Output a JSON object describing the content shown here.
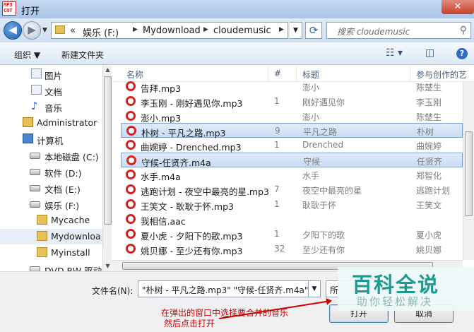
{
  "window": {
    "title": "打开",
    "app_icon_text": "MP3 CUT",
    "close_label": "✕"
  },
  "address": {
    "back_glyph": "◀",
    "forward_glyph": "▶",
    "segments": [
      "«",
      "娱乐 (F:)",
      "Mydownload",
      "cloudemusic"
    ],
    "search_placeholder": "搜索 cloudemusic"
  },
  "toolbar": {
    "organize": "组织",
    "new_folder": "新建文件夹",
    "help": "?"
  },
  "nav": {
    "items": [
      {
        "label": "图片",
        "icon": "picture-icon"
      },
      {
        "label": "文档",
        "icon": "document-icon"
      },
      {
        "label": "音乐",
        "icon": "music-icon"
      },
      {
        "label": "Administrator",
        "icon": "user-icon"
      },
      {
        "label": "计算机",
        "icon": "computer-icon"
      },
      {
        "label": "本地磁盘 (C:)",
        "icon": "drive-icon"
      },
      {
        "label": "软件 (D:)",
        "icon": "drive-icon"
      },
      {
        "label": "文档 (E:)",
        "icon": "drive-icon"
      },
      {
        "label": "娱乐 (F:)",
        "icon": "drive-icon"
      },
      {
        "label": "Mycache",
        "icon": "folder-icon"
      },
      {
        "label": "Mydownloa",
        "icon": "folder-icon"
      },
      {
        "label": "Myinstall",
        "icon": "folder-icon"
      },
      {
        "label": "DVD RW 驱动",
        "icon": "dvd-icon"
      }
    ]
  },
  "columns": {
    "name": "名称",
    "num": "#",
    "title": "标题",
    "artist": "参与创作的艺"
  },
  "files": [
    {
      "name": "告拜.mp3",
      "num": "",
      "title": "澎小",
      "artist": "陈楚生"
    },
    {
      "name": "李玉刚 - 刚好遇见你.mp3",
      "num": "1",
      "title": "刚好遇见你",
      "artist": "李玉刚"
    },
    {
      "name": "澎小.mp3",
      "num": "",
      "title": "澎小",
      "artist": "陈楚生"
    },
    {
      "name": "朴树 - 平凡之路.mp3",
      "num": "9",
      "title": "平凡之路",
      "artist": "朴树",
      "selected": true
    },
    {
      "name": "曲婉婷 - Drenched.mp3",
      "num": "1",
      "title": "Drenched",
      "artist": "曲婉婷"
    },
    {
      "name": "守候-任贤齐.m4a",
      "num": "",
      "title": "守候",
      "artist": "任贤齐",
      "selected": true
    },
    {
      "name": "水手.m4a",
      "num": "",
      "title": "水手",
      "artist": "郑智化"
    },
    {
      "name": "逃跑计划 - 夜空中最亮的星.mp3",
      "num": "7",
      "title": "夜空中最亮的星",
      "artist": "逃跑计划"
    },
    {
      "name": "王笑文 - 耿耿于怀.mp3",
      "num": "1",
      "title": "耿耿于怀",
      "artist": "王笑文"
    },
    {
      "name": "我相信.aac",
      "num": "",
      "title": "",
      "artist": ""
    },
    {
      "name": "夏小虎 - 夕阳下的歌.mp3",
      "num": "1",
      "title": "夕阳下的歌",
      "artist": "夏小虎"
    },
    {
      "name": "姚贝娜 - 至少还有你.mp3",
      "num": "32",
      "title": "至少还有你",
      "artist": "姚贝娜"
    }
  ],
  "bottom": {
    "filename_label": "文件名(N):",
    "filename_value": "\"朴树 - 平凡之路.mp3\" \"守候-任贤齐.m4a\"",
    "filetype_value": "所",
    "open_label": "打开",
    "cancel_label": "取消"
  },
  "annotation": {
    "line1": "在弹出的窗口中选择要合并的音乐",
    "line2": "然后点击打开"
  },
  "watermark": {
    "logo": "百科全说",
    "sub": "助你轻松解决"
  }
}
